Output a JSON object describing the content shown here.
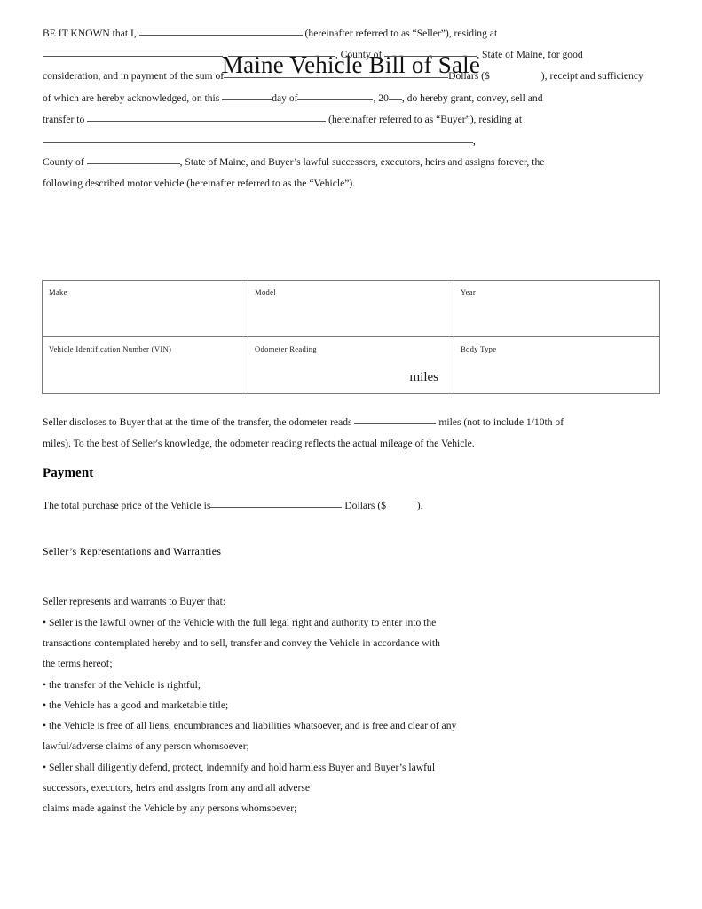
{
  "document": {
    "title": "Maine Vehicle Bill of Sale"
  },
  "intro": {
    "l1_a": "BE  IT  KNOWN  that  I,",
    "l1_b": "(hereinafter  referred  to  as  “Seller”),  residing  at",
    "l2_a": ",",
    "l2_b": ",",
    "l2_c": "County  of",
    "l2_d": ",  State  of  Maine,  for  good",
    "l3_a": "consideration, and in payment of the sum of",
    "l3_b": "Dollars ($",
    "l3_c": "), receipt and sufficiency",
    "l4_a": "of which are hereby acknowledged, on this",
    "l4_b": "day of",
    "l4_c": ", 20",
    "l4_d": ", do hereby grant, convey, sell and",
    "l5_a": "transfer  to",
    "l5_b": "(hereinafter  referred  to  as  “Buyer”),  residing  at",
    "l6_tail": ",",
    "l7_a": "County of",
    "l7_b": ",  State of Maine,  and  Buyer’s lawful successors, executors, heirs and assigns forever, the",
    "l8": "following described motor vehicle (hereinafter referred to as the “Vehicle”)."
  },
  "vehicle_table": {
    "rows": [
      {
        "cells": [
          "Make",
          "Model",
          "Year"
        ]
      },
      {
        "cells": [
          "Vehicle Identification Number (VIN)",
          "Odometer Reading",
          "Body Type"
        ]
      }
    ],
    "odometer_unit": "miles"
  },
  "odometer_disclosure": {
    "l1_a": "Seller  discloses  to  Buyer  that  at  the  time  of  the  transfer,  the  odometer  reads",
    "l1_b": "miles (not to include 1/10th of",
    "l2": "miles). To the best of Seller's knowledge, the odometer reading reflects the actual mileage of the Vehicle."
  },
  "payment": {
    "heading": "Payment",
    "line_a": "The total purchase price of the Vehicle is",
    "line_b": "Dollars ($",
    "line_c": ")."
  },
  "representations": {
    "heading": "Seller’s Representations and  Warranties",
    "intro": "Seller represents and warrants to Buyer that:",
    "items": [
      "• Seller is the lawful owner of the Vehicle with the full legal right and authority to enter into the",
      "transactions contemplated hereby and to sell, transfer and convey the Vehicle in accordance with",
      "the terms hereof;",
      "• the transfer of the Vehicle is rightful;",
      "• the Vehicle has a good and marketable title;",
      "• the Vehicle is free of all liens, encumbrances and liabilities whatsoever, and is free and clear of any",
      "lawful/adverse claims of any person whomsoever;",
      "• Seller shall diligently defend, protect, indemnify and hold harmless Buyer and Buyer’s lawful",
      "successors, executors, heirs and assigns from any and all adverse",
      "claims made against the Vehicle by any persons whomsoever;"
    ]
  }
}
